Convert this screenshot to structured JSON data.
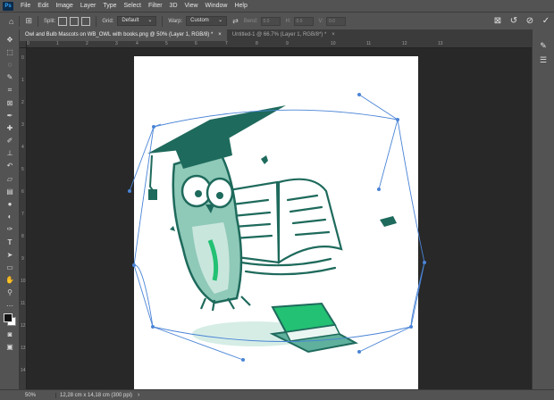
{
  "app": {
    "logo_text": "Ps"
  },
  "menu": [
    "File",
    "Edit",
    "Image",
    "Layer",
    "Type",
    "Select",
    "Filter",
    "3D",
    "View",
    "Window",
    "Help"
  ],
  "options_bar": {
    "split_label": "Split:",
    "grid_label": "Grid:",
    "grid_value": "Default",
    "warp_label": "Warp:",
    "warp_value": "Custom",
    "bend_label": "Bend:",
    "bend_value": "0.0",
    "h_label": "H:",
    "h_value": "0.0",
    "v_label": "V:",
    "v_value": "0.0"
  },
  "tabs": [
    {
      "label": "Owl and Bulb Mascots on WB_OWL with books.png @ 50% (Layer 1, RGB/8) *",
      "active": true
    },
    {
      "label": "Untitled-1 @ 66.7% (Layer 1, RGB/8*) *",
      "active": false
    }
  ],
  "tab_close_glyph": "×",
  "ruler_top": [
    "0",
    "1",
    "2",
    "3",
    "4",
    "5",
    "6",
    "7",
    "8",
    "9",
    "10",
    "11",
    "12",
    "13"
  ],
  "ruler_left": [
    "0",
    "1",
    "2",
    "3",
    "4",
    "5",
    "6",
    "7",
    "8",
    "9",
    "10",
    "11",
    "12",
    "13",
    "14"
  ],
  "tools": [
    "move-icon",
    "marquee-icon",
    "lasso-icon",
    "quick-select-icon",
    "crop-icon",
    "frame-icon",
    "eyedropper-icon",
    "healing-icon",
    "brush-icon",
    "stamp-icon",
    "history-brush-icon",
    "eraser-icon",
    "gradient-icon",
    "blur-icon",
    "dodge-icon",
    "pen-icon",
    "type-icon",
    "path-select-icon",
    "shape-icon",
    "hand-icon",
    "zoom-icon",
    "more-tools-icon"
  ],
  "status": {
    "zoom": "50%",
    "doc_info": "12,28 cm x 14,18 cm (300 ppi)"
  },
  "colors": {
    "ui_panel": "#535353",
    "workspace": "#282828",
    "owl_dark_green": "#1e6a5c",
    "owl_mid_green": "#6fb5a3",
    "owl_light_green": "#c9e6dd",
    "book_green": "#23c173",
    "warp_handle": "#4a84d6"
  }
}
